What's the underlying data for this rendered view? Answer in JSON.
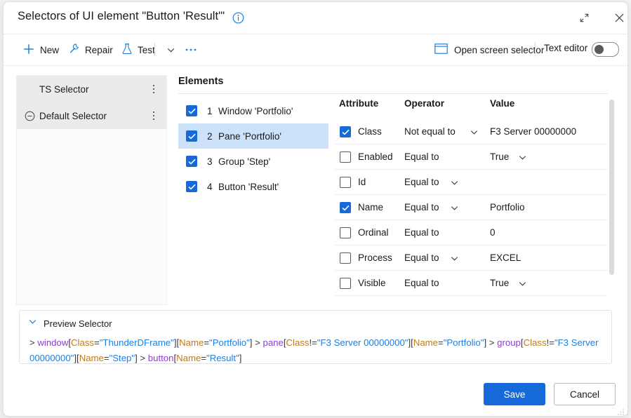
{
  "window": {
    "title": "Selectors of UI element \"Button 'Result'\"",
    "info_icon": "info-circle-icon",
    "expand_label": "expand-icon",
    "close_label": "close-icon",
    "accent_color": "#1669d8"
  },
  "toolbar": {
    "new_label": "New",
    "repair_label": "Repair",
    "test_label": "Test",
    "chevron_label": "chevron-down-icon",
    "more_label": "more-options-icon",
    "open_screen_selector_label": "Open screen selector",
    "text_editor_label": "Text editor",
    "text_editor_on": false
  },
  "sidebar": {
    "items": [
      {
        "label": "TS Selector",
        "has_collapse_icon": false
      },
      {
        "label": "Default Selector",
        "has_collapse_icon": true
      }
    ]
  },
  "elements": {
    "title": "Elements",
    "rows": [
      {
        "index": "1",
        "label": "Window 'Portfolio'",
        "checked": true,
        "selected": false
      },
      {
        "index": "2",
        "label": "Pane 'Portfolio'",
        "checked": true,
        "selected": true
      },
      {
        "index": "3",
        "label": "Group 'Step'",
        "checked": true,
        "selected": false
      },
      {
        "index": "4",
        "label": "Button 'Result'",
        "checked": true,
        "selected": false
      }
    ]
  },
  "attributes": {
    "headers": {
      "attribute": "Attribute",
      "operator": "Operator",
      "value": "Value"
    },
    "rows": [
      {
        "name": "Class",
        "operator": "Not equal to",
        "value": "F3 Server 00000000",
        "checked": true,
        "op_dropdown": true,
        "val_dropdown": false
      },
      {
        "name": "Enabled",
        "operator": "Equal to",
        "value": "True",
        "checked": false,
        "op_dropdown": false,
        "val_dropdown": true
      },
      {
        "name": "Id",
        "operator": "Equal to",
        "value": "",
        "checked": false,
        "op_dropdown": true,
        "val_dropdown": false
      },
      {
        "name": "Name",
        "operator": "Equal to",
        "value": "Portfolio",
        "checked": true,
        "op_dropdown": true,
        "val_dropdown": false
      },
      {
        "name": "Ordinal",
        "operator": "Equal to",
        "value": "0",
        "checked": false,
        "op_dropdown": false,
        "val_dropdown": false
      },
      {
        "name": "Process",
        "operator": "Equal to",
        "value": "EXCEL",
        "checked": false,
        "op_dropdown": true,
        "val_dropdown": false
      },
      {
        "name": "Visible",
        "operator": "Equal to",
        "value": "True",
        "checked": false,
        "op_dropdown": false,
        "val_dropdown": true
      }
    ]
  },
  "preview": {
    "header_label": "Preview Selector",
    "chevron": "chevron-down-icon",
    "tokens": [
      {
        "t": "punct",
        "v": "> "
      },
      {
        "t": "tag",
        "v": "window"
      },
      {
        "t": "punct",
        "v": "["
      },
      {
        "t": "attr",
        "v": "Class"
      },
      {
        "t": "punct",
        "v": "="
      },
      {
        "t": "str",
        "v": "\"ThunderDFrame\""
      },
      {
        "t": "punct",
        "v": "]["
      },
      {
        "t": "attr",
        "v": "Name"
      },
      {
        "t": "punct",
        "v": "="
      },
      {
        "t": "str",
        "v": "\"Portfolio\""
      },
      {
        "t": "punct",
        "v": "] > "
      },
      {
        "t": "tag",
        "v": "pane"
      },
      {
        "t": "punct",
        "v": "["
      },
      {
        "t": "attr",
        "v": "Class"
      },
      {
        "t": "punct",
        "v": "!="
      },
      {
        "t": "str",
        "v": "\"F3 Server 00000000\""
      },
      {
        "t": "punct",
        "v": "]["
      },
      {
        "t": "attr",
        "v": "Name"
      },
      {
        "t": "punct",
        "v": "="
      },
      {
        "t": "str",
        "v": "\"Portfolio\""
      },
      {
        "t": "punct",
        "v": "] > "
      },
      {
        "t": "tag",
        "v": "group"
      },
      {
        "t": "punct",
        "v": "["
      },
      {
        "t": "attr",
        "v": "Class"
      },
      {
        "t": "punct",
        "v": "!="
      },
      {
        "t": "str",
        "v": "\"F3 Server 00000000\""
      },
      {
        "t": "punct",
        "v": "]["
      },
      {
        "t": "attr",
        "v": "Name"
      },
      {
        "t": "punct",
        "v": "="
      },
      {
        "t": "str",
        "v": "\"Step\""
      },
      {
        "t": "punct",
        "v": "] > "
      },
      {
        "t": "tag",
        "v": "button"
      },
      {
        "t": "punct",
        "v": "["
      },
      {
        "t": "attr",
        "v": "Name"
      },
      {
        "t": "punct",
        "v": "="
      },
      {
        "t": "str",
        "v": "\"Result\""
      },
      {
        "t": "punct",
        "v": "]"
      }
    ]
  },
  "footer": {
    "save_label": "Save",
    "cancel_label": "Cancel"
  }
}
